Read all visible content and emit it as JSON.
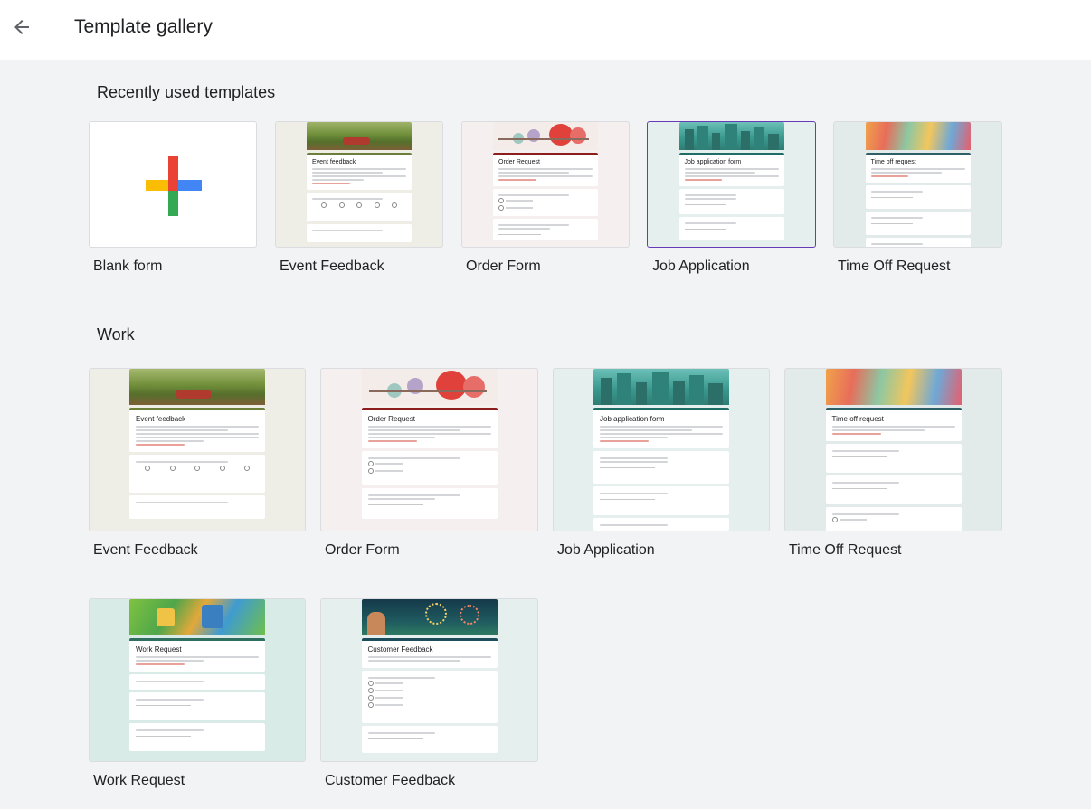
{
  "header": {
    "title": "Template gallery",
    "back_icon": "arrow-left-icon"
  },
  "sections": {
    "recent": {
      "title": "Recently used templates",
      "items": [
        {
          "label": "Blank form"
        },
        {
          "label": "Event Feedback",
          "preview_title": "Event feedback"
        },
        {
          "label": "Order Form",
          "preview_title": "Order Request"
        },
        {
          "label": "Job Application",
          "preview_title": "Job application form"
        },
        {
          "label": "Time Off Request",
          "preview_title": "Time off request"
        }
      ]
    },
    "work": {
      "title": "Work",
      "items": [
        {
          "label": "Event Feedback",
          "preview_title": "Event feedback"
        },
        {
          "label": "Order Form",
          "preview_title": "Order Request"
        },
        {
          "label": "Job Application",
          "preview_title": "Job application form"
        },
        {
          "label": "Time Off Request",
          "preview_title": "Time off request"
        },
        {
          "label": "Work Request",
          "preview_title": "Work Request"
        },
        {
          "label": "Customer Feedback",
          "preview_title": "Customer Feedback"
        }
      ]
    }
  },
  "colors": {
    "page_bg": "#f1f3f4",
    "accent_purple": "#673ab7",
    "plus_red": "#ea4335",
    "plus_blue": "#4285f4",
    "plus_green": "#34a853",
    "plus_yellow": "#fbbc04"
  }
}
